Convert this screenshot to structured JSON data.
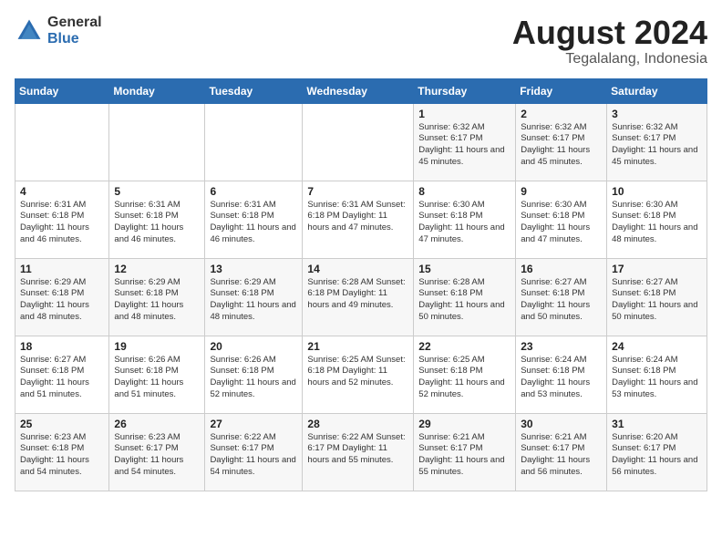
{
  "logo": {
    "general": "General",
    "blue": "Blue"
  },
  "title": {
    "month_year": "August 2024",
    "location": "Tegalalang, Indonesia"
  },
  "headers": [
    "Sunday",
    "Monday",
    "Tuesday",
    "Wednesday",
    "Thursday",
    "Friday",
    "Saturday"
  ],
  "weeks": [
    [
      {
        "day": "",
        "detail": ""
      },
      {
        "day": "",
        "detail": ""
      },
      {
        "day": "",
        "detail": ""
      },
      {
        "day": "",
        "detail": ""
      },
      {
        "day": "1",
        "detail": "Sunrise: 6:32 AM\nSunset: 6:17 PM\nDaylight: 11 hours\nand 45 minutes."
      },
      {
        "day": "2",
        "detail": "Sunrise: 6:32 AM\nSunset: 6:17 PM\nDaylight: 11 hours\nand 45 minutes."
      },
      {
        "day": "3",
        "detail": "Sunrise: 6:32 AM\nSunset: 6:17 PM\nDaylight: 11 hours\nand 45 minutes."
      }
    ],
    [
      {
        "day": "4",
        "detail": "Sunrise: 6:31 AM\nSunset: 6:18 PM\nDaylight: 11 hours\nand 46 minutes."
      },
      {
        "day": "5",
        "detail": "Sunrise: 6:31 AM\nSunset: 6:18 PM\nDaylight: 11 hours\nand 46 minutes."
      },
      {
        "day": "6",
        "detail": "Sunrise: 6:31 AM\nSunset: 6:18 PM\nDaylight: 11 hours\nand 46 minutes."
      },
      {
        "day": "7",
        "detail": "Sunrise: 6:31 AM\nSunset: 6:18 PM\nDaylight: 11 hours\nand 47 minutes."
      },
      {
        "day": "8",
        "detail": "Sunrise: 6:30 AM\nSunset: 6:18 PM\nDaylight: 11 hours\nand 47 minutes."
      },
      {
        "day": "9",
        "detail": "Sunrise: 6:30 AM\nSunset: 6:18 PM\nDaylight: 11 hours\nand 47 minutes."
      },
      {
        "day": "10",
        "detail": "Sunrise: 6:30 AM\nSunset: 6:18 PM\nDaylight: 11 hours\nand 48 minutes."
      }
    ],
    [
      {
        "day": "11",
        "detail": "Sunrise: 6:29 AM\nSunset: 6:18 PM\nDaylight: 11 hours\nand 48 minutes."
      },
      {
        "day": "12",
        "detail": "Sunrise: 6:29 AM\nSunset: 6:18 PM\nDaylight: 11 hours\nand 48 minutes."
      },
      {
        "day": "13",
        "detail": "Sunrise: 6:29 AM\nSunset: 6:18 PM\nDaylight: 11 hours\nand 48 minutes."
      },
      {
        "day": "14",
        "detail": "Sunrise: 6:28 AM\nSunset: 6:18 PM\nDaylight: 11 hours\nand 49 minutes."
      },
      {
        "day": "15",
        "detail": "Sunrise: 6:28 AM\nSunset: 6:18 PM\nDaylight: 11 hours\nand 50 minutes."
      },
      {
        "day": "16",
        "detail": "Sunrise: 6:27 AM\nSunset: 6:18 PM\nDaylight: 11 hours\nand 50 minutes."
      },
      {
        "day": "17",
        "detail": "Sunrise: 6:27 AM\nSunset: 6:18 PM\nDaylight: 11 hours\nand 50 minutes."
      }
    ],
    [
      {
        "day": "18",
        "detail": "Sunrise: 6:27 AM\nSunset: 6:18 PM\nDaylight: 11 hours\nand 51 minutes."
      },
      {
        "day": "19",
        "detail": "Sunrise: 6:26 AM\nSunset: 6:18 PM\nDaylight: 11 hours\nand 51 minutes."
      },
      {
        "day": "20",
        "detail": "Sunrise: 6:26 AM\nSunset: 6:18 PM\nDaylight: 11 hours\nand 52 minutes."
      },
      {
        "day": "21",
        "detail": "Sunrise: 6:25 AM\nSunset: 6:18 PM\nDaylight: 11 hours\nand 52 minutes."
      },
      {
        "day": "22",
        "detail": "Sunrise: 6:25 AM\nSunset: 6:18 PM\nDaylight: 11 hours\nand 52 minutes."
      },
      {
        "day": "23",
        "detail": "Sunrise: 6:24 AM\nSunset: 6:18 PM\nDaylight: 11 hours\nand 53 minutes."
      },
      {
        "day": "24",
        "detail": "Sunrise: 6:24 AM\nSunset: 6:18 PM\nDaylight: 11 hours\nand 53 minutes."
      }
    ],
    [
      {
        "day": "25",
        "detail": "Sunrise: 6:23 AM\nSunset: 6:18 PM\nDaylight: 11 hours\nand 54 minutes."
      },
      {
        "day": "26",
        "detail": "Sunrise: 6:23 AM\nSunset: 6:17 PM\nDaylight: 11 hours\nand 54 minutes."
      },
      {
        "day": "27",
        "detail": "Sunrise: 6:22 AM\nSunset: 6:17 PM\nDaylight: 11 hours\nand 54 minutes."
      },
      {
        "day": "28",
        "detail": "Sunrise: 6:22 AM\nSunset: 6:17 PM\nDaylight: 11 hours\nand 55 minutes."
      },
      {
        "day": "29",
        "detail": "Sunrise: 6:21 AM\nSunset: 6:17 PM\nDaylight: 11 hours\nand 55 minutes."
      },
      {
        "day": "30",
        "detail": "Sunrise: 6:21 AM\nSunset: 6:17 PM\nDaylight: 11 hours\nand 56 minutes."
      },
      {
        "day": "31",
        "detail": "Sunrise: 6:20 AM\nSunset: 6:17 PM\nDaylight: 11 hours\nand 56 minutes."
      }
    ]
  ]
}
